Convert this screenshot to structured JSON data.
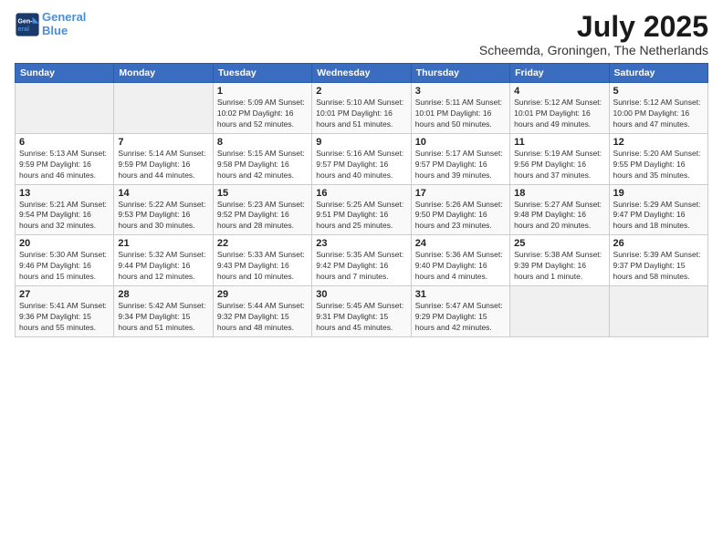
{
  "logo": {
    "line1": "General",
    "line2": "Blue"
  },
  "title": "July 2025",
  "subtitle": "Scheemda, Groningen, The Netherlands",
  "headers": [
    "Sunday",
    "Monday",
    "Tuesday",
    "Wednesday",
    "Thursday",
    "Friday",
    "Saturday"
  ],
  "weeks": [
    [
      {
        "day": "",
        "info": ""
      },
      {
        "day": "",
        "info": ""
      },
      {
        "day": "1",
        "info": "Sunrise: 5:09 AM\nSunset: 10:02 PM\nDaylight: 16 hours\nand 52 minutes."
      },
      {
        "day": "2",
        "info": "Sunrise: 5:10 AM\nSunset: 10:01 PM\nDaylight: 16 hours\nand 51 minutes."
      },
      {
        "day": "3",
        "info": "Sunrise: 5:11 AM\nSunset: 10:01 PM\nDaylight: 16 hours\nand 50 minutes."
      },
      {
        "day": "4",
        "info": "Sunrise: 5:12 AM\nSunset: 10:01 PM\nDaylight: 16 hours\nand 49 minutes."
      },
      {
        "day": "5",
        "info": "Sunrise: 5:12 AM\nSunset: 10:00 PM\nDaylight: 16 hours\nand 47 minutes."
      }
    ],
    [
      {
        "day": "6",
        "info": "Sunrise: 5:13 AM\nSunset: 9:59 PM\nDaylight: 16 hours\nand 46 minutes."
      },
      {
        "day": "7",
        "info": "Sunrise: 5:14 AM\nSunset: 9:59 PM\nDaylight: 16 hours\nand 44 minutes."
      },
      {
        "day": "8",
        "info": "Sunrise: 5:15 AM\nSunset: 9:58 PM\nDaylight: 16 hours\nand 42 minutes."
      },
      {
        "day": "9",
        "info": "Sunrise: 5:16 AM\nSunset: 9:57 PM\nDaylight: 16 hours\nand 40 minutes."
      },
      {
        "day": "10",
        "info": "Sunrise: 5:17 AM\nSunset: 9:57 PM\nDaylight: 16 hours\nand 39 minutes."
      },
      {
        "day": "11",
        "info": "Sunrise: 5:19 AM\nSunset: 9:56 PM\nDaylight: 16 hours\nand 37 minutes."
      },
      {
        "day": "12",
        "info": "Sunrise: 5:20 AM\nSunset: 9:55 PM\nDaylight: 16 hours\nand 35 minutes."
      }
    ],
    [
      {
        "day": "13",
        "info": "Sunrise: 5:21 AM\nSunset: 9:54 PM\nDaylight: 16 hours\nand 32 minutes."
      },
      {
        "day": "14",
        "info": "Sunrise: 5:22 AM\nSunset: 9:53 PM\nDaylight: 16 hours\nand 30 minutes."
      },
      {
        "day": "15",
        "info": "Sunrise: 5:23 AM\nSunset: 9:52 PM\nDaylight: 16 hours\nand 28 minutes."
      },
      {
        "day": "16",
        "info": "Sunrise: 5:25 AM\nSunset: 9:51 PM\nDaylight: 16 hours\nand 25 minutes."
      },
      {
        "day": "17",
        "info": "Sunrise: 5:26 AM\nSunset: 9:50 PM\nDaylight: 16 hours\nand 23 minutes."
      },
      {
        "day": "18",
        "info": "Sunrise: 5:27 AM\nSunset: 9:48 PM\nDaylight: 16 hours\nand 20 minutes."
      },
      {
        "day": "19",
        "info": "Sunrise: 5:29 AM\nSunset: 9:47 PM\nDaylight: 16 hours\nand 18 minutes."
      }
    ],
    [
      {
        "day": "20",
        "info": "Sunrise: 5:30 AM\nSunset: 9:46 PM\nDaylight: 16 hours\nand 15 minutes."
      },
      {
        "day": "21",
        "info": "Sunrise: 5:32 AM\nSunset: 9:44 PM\nDaylight: 16 hours\nand 12 minutes."
      },
      {
        "day": "22",
        "info": "Sunrise: 5:33 AM\nSunset: 9:43 PM\nDaylight: 16 hours\nand 10 minutes."
      },
      {
        "day": "23",
        "info": "Sunrise: 5:35 AM\nSunset: 9:42 PM\nDaylight: 16 hours\nand 7 minutes."
      },
      {
        "day": "24",
        "info": "Sunrise: 5:36 AM\nSunset: 9:40 PM\nDaylight: 16 hours\nand 4 minutes."
      },
      {
        "day": "25",
        "info": "Sunrise: 5:38 AM\nSunset: 9:39 PM\nDaylight: 16 hours\nand 1 minute."
      },
      {
        "day": "26",
        "info": "Sunrise: 5:39 AM\nSunset: 9:37 PM\nDaylight: 15 hours\nand 58 minutes."
      }
    ],
    [
      {
        "day": "27",
        "info": "Sunrise: 5:41 AM\nSunset: 9:36 PM\nDaylight: 15 hours\nand 55 minutes."
      },
      {
        "day": "28",
        "info": "Sunrise: 5:42 AM\nSunset: 9:34 PM\nDaylight: 15 hours\nand 51 minutes."
      },
      {
        "day": "29",
        "info": "Sunrise: 5:44 AM\nSunset: 9:32 PM\nDaylight: 15 hours\nand 48 minutes."
      },
      {
        "day": "30",
        "info": "Sunrise: 5:45 AM\nSunset: 9:31 PM\nDaylight: 15 hours\nand 45 minutes."
      },
      {
        "day": "31",
        "info": "Sunrise: 5:47 AM\nSunset: 9:29 PM\nDaylight: 15 hours\nand 42 minutes."
      },
      {
        "day": "",
        "info": ""
      },
      {
        "day": "",
        "info": ""
      }
    ]
  ]
}
